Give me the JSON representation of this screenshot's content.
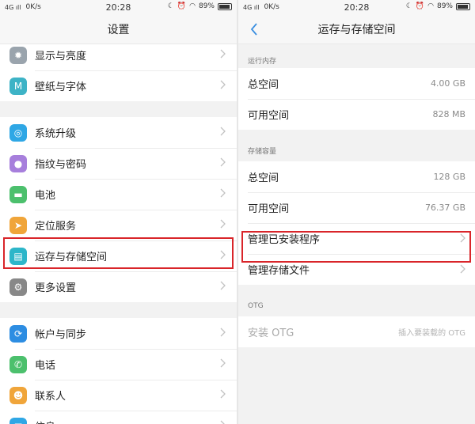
{
  "status": {
    "left_signal": "4G ıll",
    "speed": "0K/s",
    "time": "20:28",
    "battery": "89%",
    "right_signal": "4G ıll",
    "right_speed": "0K/s"
  },
  "left": {
    "title": "设置",
    "groups": [
      [
        {
          "label": "显示与亮度",
          "icon": "display-icon",
          "color": "#9aa4ad"
        },
        {
          "label": "壁纸与字体",
          "icon": "wallpaper-icon",
          "color": "#3db3c6"
        }
      ],
      [
        {
          "label": "系统升级",
          "icon": "system-update-icon",
          "color": "#2fa7e5"
        },
        {
          "label": "指纹与密码",
          "icon": "fingerprint-icon",
          "color": "#a77fdc"
        },
        {
          "label": "电池",
          "icon": "battery-icon",
          "color": "#4cc06d"
        },
        {
          "label": "定位服务",
          "icon": "location-icon",
          "color": "#f0a53a"
        },
        {
          "label": "运存与存储空间",
          "icon": "storage-icon",
          "color": "#2db6c9"
        },
        {
          "label": "更多设置",
          "icon": "more-settings-icon",
          "color": "#888888"
        }
      ],
      [
        {
          "label": "帐户与同步",
          "icon": "account-sync-icon",
          "color": "#2d8de2"
        },
        {
          "label": "电话",
          "icon": "phone-icon",
          "color": "#4cc06d"
        },
        {
          "label": "联系人",
          "icon": "contacts-icon",
          "color": "#f0a53a"
        },
        {
          "label": "信息",
          "icon": "messages-icon",
          "color": "#2fa7e5"
        }
      ]
    ]
  },
  "right": {
    "title": "运存与存储空间",
    "ram_header": "运行内存",
    "ram_total_label": "总空间",
    "ram_total_value": "4.00 GB",
    "ram_free_label": "可用空间",
    "ram_free_value": "828 MB",
    "storage_header": "存储容量",
    "storage_total_label": "总空间",
    "storage_total_value": "128 GB",
    "storage_free_label": "可用空间",
    "storage_free_value": "76.37 GB",
    "manage_apps_label": "管理已安装程序",
    "manage_files_label": "管理存储文件",
    "otg_header": "OTG",
    "otg_label": "安装 OTG",
    "otg_value": "插入要装载的 OTG"
  },
  "colors": {
    "highlight": "#d9252a",
    "accent": "#2d8de2"
  }
}
